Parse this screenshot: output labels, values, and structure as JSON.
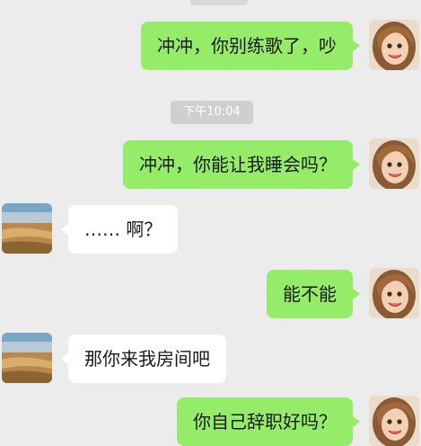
{
  "chat": {
    "timestamp": "下午10:04",
    "messages": [
      {
        "sender": "me",
        "text": "冲冲，你别练歌了，吵"
      },
      {
        "sender": "me",
        "text": "冲冲，你能让我睡会吗？"
      },
      {
        "sender": "other",
        "text": "…… 啊？"
      },
      {
        "sender": "me",
        "text": "能不能"
      },
      {
        "sender": "other",
        "text": "那你来我房间吧"
      },
      {
        "sender": "me",
        "text": "你自己辞职好吗？"
      }
    ]
  },
  "avatars": {
    "me": "girl-portrait-icon",
    "other": "desert-landscape-icon"
  },
  "colors": {
    "background": "#ececec",
    "sent_bubble": "#95ec69",
    "received_bubble": "#ffffff",
    "timestamp_bg": "#cfcfcf",
    "text": "#1a1a1a"
  }
}
